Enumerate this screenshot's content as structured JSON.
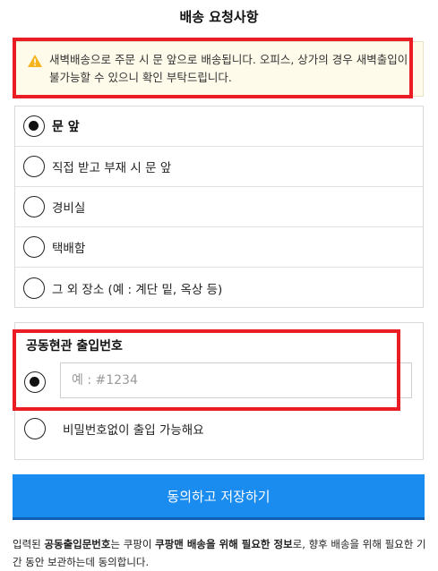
{
  "header": {
    "title": "배송 요청사항"
  },
  "notice": {
    "icon": "warning-icon",
    "icon_color": "#f5b31d",
    "text": "새벽배송으로 주문 시 문 앞으로 배송됩니다. 오피스, 상가의 경우 새벽출입이 불가능할 수 있으니 확인 부탁드립니다."
  },
  "options": [
    {
      "label": "문 앞",
      "checked": true
    },
    {
      "label": "직접 받고 부재 시 문 앞",
      "checked": false
    },
    {
      "label": "경비실",
      "checked": false
    },
    {
      "label": "택배함",
      "checked": false
    },
    {
      "label": "그 외 장소 (예 : 계단 밑, 옥상 등)",
      "checked": false
    }
  ],
  "entry": {
    "title": "공동현관 출입번호",
    "input_value": "",
    "input_placeholder": "예 : #1234",
    "no_password_label": "비밀번호없이 출입 가능해요"
  },
  "agree_button": {
    "label": "동의하고 저장하기",
    "color": "#1a8cf0"
  },
  "consent": {
    "part1": "입력된 ",
    "bold1": "공동출입문번호",
    "part2": "는 쿠팡이 ",
    "bold2": "쿠팡맨 배송을 위해 필요한 정보",
    "part3": "로, 향후 배송을 위해 필요한 기간 동안 보관하는데 동의합니다."
  },
  "highlight_color": "#ea1c24"
}
